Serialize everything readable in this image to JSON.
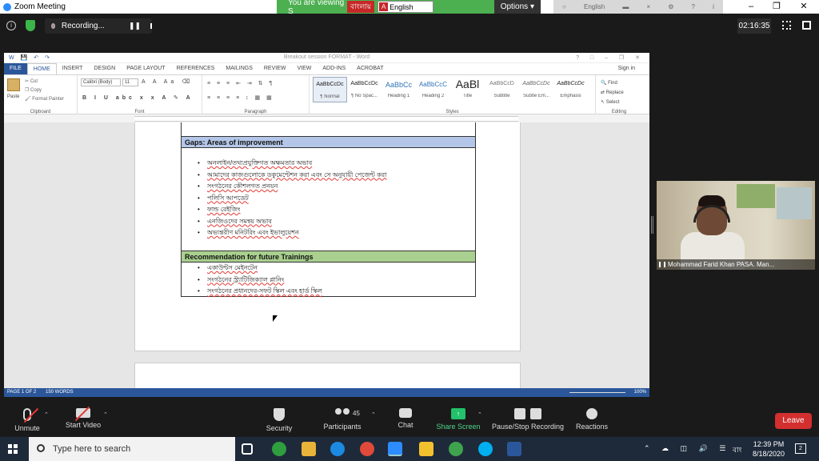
{
  "zoom_window": {
    "title": "Zoom Meeting",
    "viewing_banner": "You are viewing S",
    "bangla_button": "বাংলায়",
    "language": "English",
    "options_label": "Options",
    "ime_label": "English"
  },
  "recording": {
    "label": "Recording...",
    "timer": "02:16:35"
  },
  "word": {
    "doc_title": "Breakout session FORMAT - Word",
    "tabs": [
      "FILE",
      "HOME",
      "INSERT",
      "DESIGN",
      "PAGE LAYOUT",
      "REFERENCES",
      "MAILINGS",
      "REVIEW",
      "VIEW",
      "ADD-INS",
      "ACROBAT"
    ],
    "sign_in": "Sign in",
    "clipboard": {
      "paste": "Paste",
      "cut": "Cut",
      "copy": "Copy",
      "format_painter": "Format Painter",
      "label": "Clipboard"
    },
    "font": {
      "name": "Calibri (Body)",
      "size": "11",
      "label": "Font"
    },
    "paragraph_label": "Paragraph",
    "styles": [
      {
        "sample": "AaBbCcDc",
        "name": "¶ Normal"
      },
      {
        "sample": "AaBbCcDc",
        "name": "¶ No Spac..."
      },
      {
        "sample": "AaBbCc",
        "name": "Heading 1"
      },
      {
        "sample": "AaBbCcC",
        "name": "Heading 2"
      },
      {
        "sample": "AaBl",
        "name": "Title"
      },
      {
        "sample": "AaBbCcD",
        "name": "Subtitle"
      },
      {
        "sample": "AaBbCcDc",
        "name": "Subtle Em..."
      },
      {
        "sample": "AaBbCcDc",
        "name": "Emphasis"
      }
    ],
    "styles_label": "Styles",
    "editing": {
      "find": "Find",
      "replace": "Replace",
      "select": "Select",
      "label": "Editing"
    },
    "document": {
      "gaps_heading": "Gaps: Areas of improvement",
      "gaps_items": [
        "অনলাইন/তথ্যপ্রযুক্তিগত অক্ষমতার অভাব",
        "আমাদের কাজগুলোকে ডকুমেন্টেশন করা এবং সে অনুযায়ী পেজেন্ট করা",
        "সংগঠনের কৌশলগত প্রনয়ন",
        "পলিসি আপডেট",
        "ফান্ড রেইজিং",
        "এনজিওদের সমন্বয় অভাব",
        "অভ্যন্তরীণ মনিটরিং এবং ইভালুয়েশন"
      ],
      "rec_heading": "Recommendation for future Trainings",
      "rec_items": [
        "একাউন্টস মেইনটেন",
        "সংগঠনের স্ট্র্যাটিজিক্যাল প্লানিং",
        "সংগঠনের প্রধানদের-সফট স্কিল এবং হার্ড স্কিল"
      ]
    },
    "status": {
      "page": "PAGE 1 OF 2",
      "words": "150 WORDS",
      "zoom": "100%"
    }
  },
  "video": {
    "participant_name": "Mohammad Farid Khan PASA. Man..."
  },
  "toolbar": {
    "unmute": "Unmute",
    "start_video": "Start Video",
    "security": "Security",
    "participants": "Participants",
    "participants_count": "45",
    "chat": "Chat",
    "share_screen": "Share Screen",
    "pause_stop_recording": "Pause/Stop Recording",
    "reactions": "Reactions",
    "leave": "Leave"
  },
  "taskbar": {
    "search_placeholder": "Type here to search",
    "ime": "বাং",
    "time": "12:39 PM",
    "date": "8/18/2020",
    "notifications": "2"
  }
}
